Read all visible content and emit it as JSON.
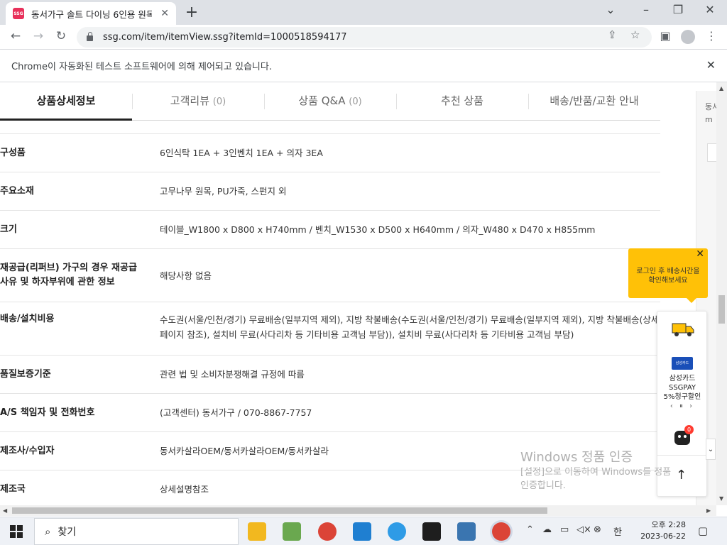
{
  "browser": {
    "tab_title": "동서가구 솔트 다이닝 6인용 원목",
    "favicon_text": "SSG",
    "url": "ssg.com/item/itemView.ssg?itemId=1000518594177",
    "infobar": "Chrome이 자동화된 테스트 소프트웨어에 의해 제어되고 있습니다."
  },
  "product_tabs": [
    {
      "label": "상품상세정보",
      "count": ""
    },
    {
      "label": "고객리뷰",
      "count": "(0)"
    },
    {
      "label": "상품 Q&A",
      "count": "(0)"
    },
    {
      "label": "추천 상품",
      "count": ""
    },
    {
      "label": "배송/반품/교환 안내",
      "count": ""
    }
  ],
  "spec_rows": [
    {
      "key": "구성품",
      "value": "6인식탁 1EA + 3인벤치 1EA + 의자 3EA"
    },
    {
      "key": "주요소재",
      "value": "고무나무 원목, PU가죽, 스펀지 외"
    },
    {
      "key": "크기",
      "value": "테이블_W1800 x D800 x H740mm / 벤치_W1530 x D500 x H640mm / 의자_W480 x D470 x H855mm"
    },
    {
      "key": "재공급(리퍼브) 가구의 경우 재공급 사유 및 하자부위에 관한 정보",
      "value": "해당사항 없음"
    },
    {
      "key": "배송/설치비용",
      "value": "수도권(서울/인천/경기) 무료배송(일부지역 제외), 지방 착불배송(수도권(서울/인천/경기) 무료배송(일부지역 제외), 지방 착불배송(상세페이지 참조), 설치비 무료(사다리차 등 기타비용 고객님 부담)), 설치비 무료(사다리차 등 기타비용 고객님 부담)"
    },
    {
      "key": "품질보증기준",
      "value": "관련 법 및 소비자분쟁해결 규정에 따름"
    },
    {
      "key": "A/S 책임자 및 전화번호",
      "value": "(고객센터) 동서가구 / 070-8867-7757"
    },
    {
      "key": "제조사/수입자",
      "value": "동서카살라OEM/동서카살라OEM/동서카살라"
    },
    {
      "key": "제조국",
      "value": "상세설명참조"
    }
  ],
  "rail_text": "동서\nm",
  "tooltip": "로그인 후 배송시간을\n확인해보세요",
  "float": {
    "card_logo": "삼성카드",
    "card_text": "삼성카드\nSSGPAY\n5%청구할인",
    "pager": "‹ ⏸ ›",
    "bot_badge": "0"
  },
  "watermark": {
    "title": "Windows 정품 인증",
    "body": "[설정]으로 이동하여 Windows를 정품\n인증합니다."
  },
  "taskbar": {
    "search_placeholder": "찾기",
    "ime": "한",
    "time": "오후 2:28",
    "date": "2023-06-22"
  }
}
